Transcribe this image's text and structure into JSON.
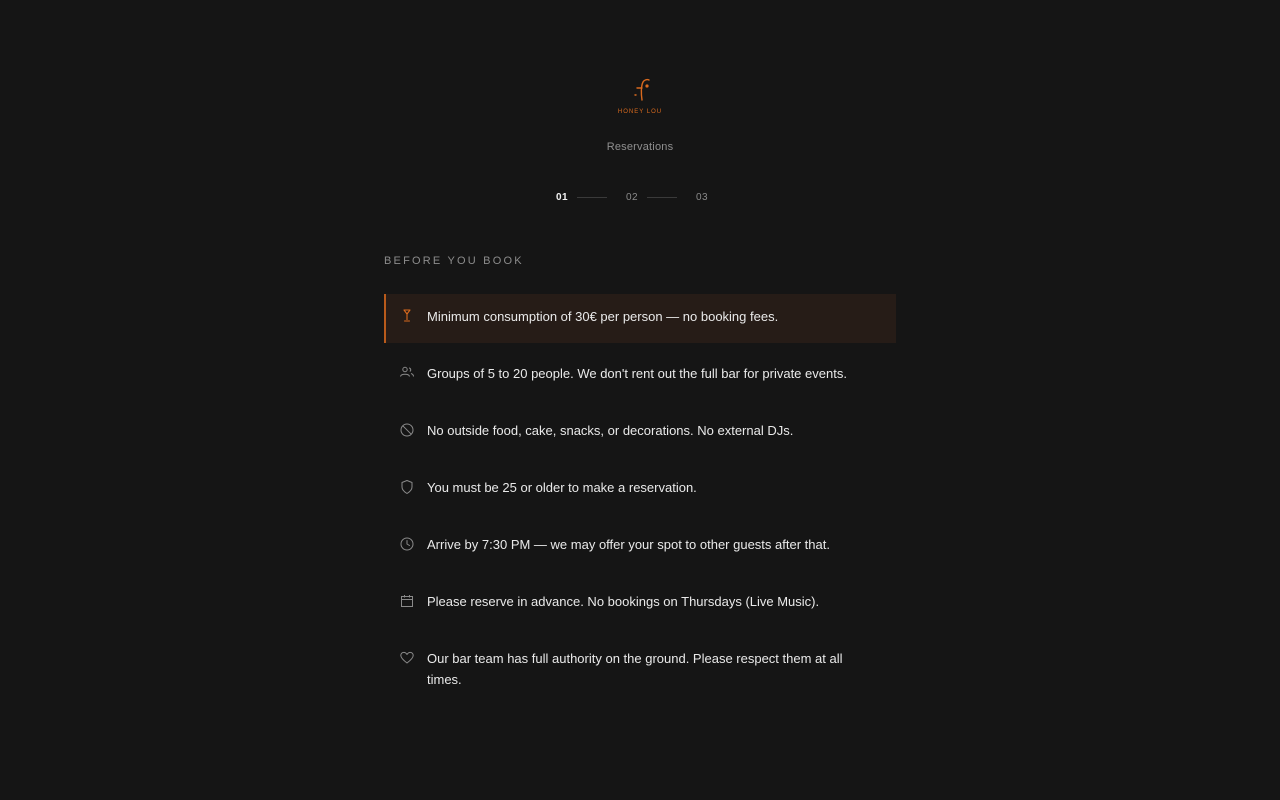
{
  "brand": {
    "logo_text": "HONEY LOU",
    "accent_color": "#d96a1e"
  },
  "header": {
    "subtitle": "Reservations"
  },
  "steps": [
    {
      "label": "01",
      "active": true
    },
    {
      "label": "02",
      "active": false
    },
    {
      "label": "03",
      "active": false
    }
  ],
  "section": {
    "title": "BEFORE YOU BOOK"
  },
  "rules": [
    {
      "icon": "cocktail-icon",
      "text": "Minimum consumption of 30€ per person — no booking fees.",
      "highlight": true
    },
    {
      "icon": "group-icon",
      "text": "Groups of 5 to 20 people. We don't rent out the full bar for private events.",
      "highlight": false
    },
    {
      "icon": "prohibited-icon",
      "text": "No outside food, cake, snacks, or decorations. No external DJs.",
      "highlight": false
    },
    {
      "icon": "shield-icon",
      "text": "You must be 25 or older to make a reservation.",
      "highlight": false
    },
    {
      "icon": "clock-icon",
      "text": "Arrive by 7:30 PM — we may offer your spot to other guests after that.",
      "highlight": false
    },
    {
      "icon": "calendar-icon",
      "text": "Please reserve in advance. No bookings on Thursdays (Live Music).",
      "highlight": false
    },
    {
      "icon": "heart-icon",
      "text": "Our bar team has full authority on the ground. Please respect them at all times.",
      "highlight": false
    }
  ]
}
